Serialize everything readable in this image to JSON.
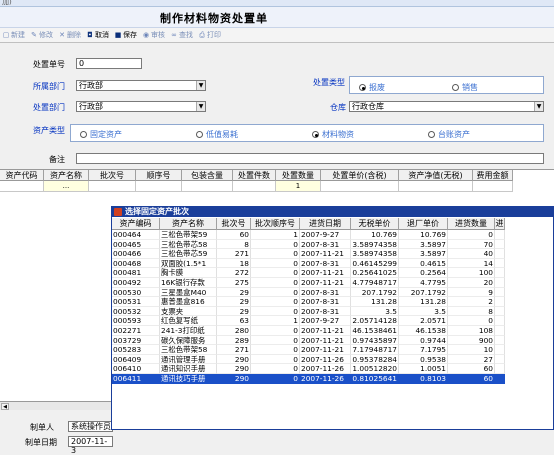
{
  "titlebar": {
    "text": "加)"
  },
  "form_title": "制作材料物资处置单",
  "toolbar": {
    "items": [
      {
        "label": "新建",
        "icon": "new-doc-icon",
        "glyph": "▢",
        "dark": false
      },
      {
        "label": "修改",
        "icon": "edit-pencil-icon",
        "glyph": "✎",
        "dark": false
      },
      {
        "label": "删除",
        "icon": "delete-x-icon",
        "glyph": "✕",
        "dark": false
      },
      {
        "label": "取消",
        "icon": "cancel-icon",
        "glyph": "◘",
        "dark": true
      },
      {
        "label": "保存",
        "icon": "save-disk-icon",
        "glyph": "■",
        "dark": true
      },
      {
        "label": "审核",
        "icon": "review-eye-icon",
        "glyph": "◉",
        "dark": false
      },
      {
        "label": "查找",
        "icon": "find-binoculars-icon",
        "glyph": "∞",
        "dark": false
      },
      {
        "label": "打印",
        "icon": "print-icon",
        "glyph": "⎙",
        "dark": false
      }
    ]
  },
  "form": {
    "doc_no_label": "处置单号",
    "doc_no_value": "0",
    "dept_label": "所属部门",
    "dept_value": "行政部",
    "disposal_type_label": "处置类型",
    "disposal_options": [
      {
        "label": "报废",
        "checked": true
      },
      {
        "label": "销售",
        "checked": false
      }
    ],
    "disposal_dept_label": "处置部门",
    "disposal_dept_value": "行政部",
    "warehouse_label": "仓库",
    "warehouse_value": "行政仓库",
    "asset_type_label": "资产类型",
    "asset_options": [
      {
        "label": "固定资产",
        "checked": false
      },
      {
        "label": "低值易耗",
        "checked": false
      },
      {
        "label": "材料物资",
        "checked": true
      },
      {
        "label": "台账资产",
        "checked": false
      }
    ],
    "remark_label": "备注",
    "remark_value": ""
  },
  "grid": {
    "columns": [
      "资产代码",
      "资产名称",
      "批次号",
      "顺序号",
      "包装含量",
      "处置件数",
      "处置数量",
      "处置单价(含税)",
      "资产净值(无税)",
      "费用金额"
    ],
    "row": {
      "code_btn": "...",
      "qty": "1"
    }
  },
  "footer": {
    "maker_label": "制单人",
    "maker_value": "系统操作员",
    "date_label": "制单日期",
    "date_value": "2007-11-3"
  },
  "popup": {
    "title": "选择固定资产批次",
    "columns": [
      "资产编码",
      "资产名称",
      "批次号",
      "批次顺序号",
      "进货日期",
      "无税单价",
      "退厂单价",
      "进货数量",
      "进"
    ],
    "rows": [
      [
        "000464",
        "三松色带架59",
        "60",
        "1",
        "2007-9-27",
        "10.769",
        "10.769",
        "0"
      ],
      [
        "000465",
        "三松色带芯58",
        "8",
        "0",
        "2007-8-31",
        "3.58974358",
        "3.5897",
        "70"
      ],
      [
        "000466",
        "三松色带芯59",
        "271",
        "0",
        "2007-11-21",
        "3.58974358",
        "3.5897",
        "40"
      ],
      [
        "000468",
        "双面胶(1.5*1",
        "18",
        "0",
        "2007-8-31",
        "0.46145299",
        "0.4615",
        "14"
      ],
      [
        "000481",
        "胸卡膜",
        "272",
        "0",
        "2007-11-21",
        "0.25641025",
        "0.2564",
        "100"
      ],
      [
        "000492",
        "16K银行存款",
        "275",
        "0",
        "2007-11-21",
        "4.77948717",
        "4.7795",
        "20"
      ],
      [
        "000530",
        "三星墨盒M40",
        "29",
        "0",
        "2007-8-31",
        "207.1792",
        "207.1792",
        "9"
      ],
      [
        "000531",
        "惠普墨盒816",
        "29",
        "0",
        "2007-8-31",
        "131.28",
        "131.28",
        "2"
      ],
      [
        "000532",
        "支票夹",
        "29",
        "0",
        "2007-8-31",
        "3.5",
        "3.5",
        "8"
      ],
      [
        "000593",
        "红色复写纸",
        "63",
        "1",
        "2007-9-27",
        "2.05714128",
        "2.0571",
        "0"
      ],
      [
        "002271",
        "241-3打印纸",
        "280",
        "0",
        "2007-11-21",
        "46.1538461",
        "46.1538",
        "108"
      ],
      [
        "003729",
        "碳久保障服务",
        "289",
        "0",
        "2007-11-21",
        "0.97435897",
        "0.9744",
        "900"
      ],
      [
        "005283",
        "三松色带架58",
        "271",
        "0",
        "2007-11-21",
        "7.17948717",
        "7.1795",
        "10"
      ],
      [
        "006409",
        "通讯管理手册",
        "290",
        "0",
        "2007-11-26",
        "0.95378284",
        "0.9538",
        "27"
      ],
      [
        "006410",
        "通讯知识手册",
        "290",
        "0",
        "2007-11-26",
        "1.00512820",
        "1.0051",
        "60"
      ],
      [
        "006411",
        "通讯技巧手册",
        "290",
        "0",
        "2007-11-26",
        "0.81025641",
        "0.8103",
        "60"
      ]
    ],
    "selected_index": 15
  }
}
